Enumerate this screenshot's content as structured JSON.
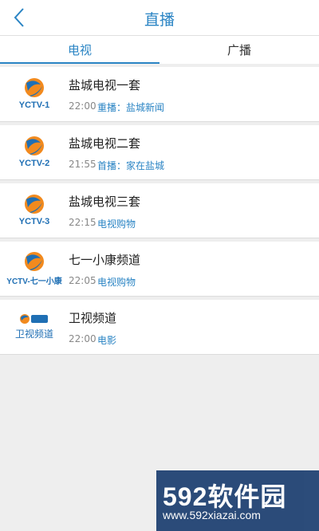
{
  "header": {
    "title": "直播"
  },
  "tabs": [
    {
      "label": "电视",
      "active": true
    },
    {
      "label": "广播",
      "active": false
    }
  ],
  "channels": [
    {
      "logo": "YCTV-1",
      "name": "盐城电视一套",
      "time": "22:00",
      "program": "重播：盐城新闻"
    },
    {
      "logo": "YCTV-2",
      "name": "盐城电视二套",
      "time": "21:55",
      "program": "首播：家在盐城"
    },
    {
      "logo": "YCTV-3",
      "name": "盐城电视三套",
      "time": "22:15",
      "program": "电视购物"
    },
    {
      "logo": "YCTV-七一小康",
      "name": "七一小康频道",
      "time": "22:05",
      "program": "电视购物"
    },
    {
      "logo": "卫视频道",
      "name": "卫视频道",
      "time": "22:00",
      "program": "电影"
    }
  ],
  "watermark": {
    "brand": "592软件园",
    "url": "www.592xiazai.com"
  },
  "colors": {
    "accent": "#2a84c4",
    "logo_blue": "#1f6fb4",
    "logo_orange": "#f28a1e"
  }
}
